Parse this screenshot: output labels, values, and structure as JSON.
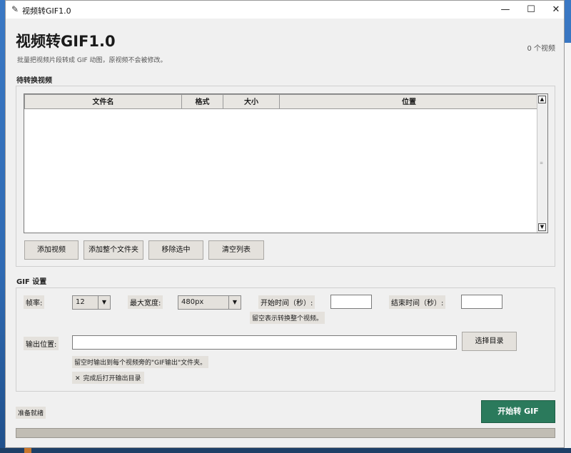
{
  "window": {
    "title": "视频转GIF1.0",
    "min_glyph": "—",
    "max_glyph": "☐",
    "close_glyph": "✕"
  },
  "header": {
    "title": "视频转GIF1.0",
    "subtitle": "批量把视频片段转成 GIF 动图，原视频不会被修改。",
    "video_count": "0 个视频"
  },
  "queue": {
    "label": "待转换视频",
    "columns": [
      "文件名",
      "格式",
      "大小",
      "位置"
    ],
    "rows": [],
    "buttons": {
      "add_video": "添加视频",
      "add_folder": "添加整个文件夹",
      "remove_selected": "移除选中",
      "clear_list": "清空列表"
    }
  },
  "settings": {
    "label": "GIF 设置",
    "fps_label": "帧率:",
    "fps_value": "12",
    "max_width_label": "最大宽度:",
    "max_width_value": "480px",
    "start_time_label": "开始时间（秒）:",
    "start_time_value": "",
    "end_time_label": "结束时间（秒）:",
    "end_time_value": "",
    "time_hint": "留空表示转换整个视频。",
    "output_label": "输出位置:",
    "output_value": "",
    "browse_button": "选择目录",
    "output_hint": "留空时输出到每个视频旁的\"GIF输出\"文件夹。",
    "open_after_label": "完成后打开输出目录",
    "open_after_checked": true
  },
  "footer": {
    "status": "准备就绪",
    "start_button": "开始转 GIF",
    "progress": 0
  },
  "colors": {
    "accent": "#2b7a5c",
    "panel": "#f0f0f0",
    "button": "#e4e1dc",
    "progress_track": "#c1bdb4"
  }
}
